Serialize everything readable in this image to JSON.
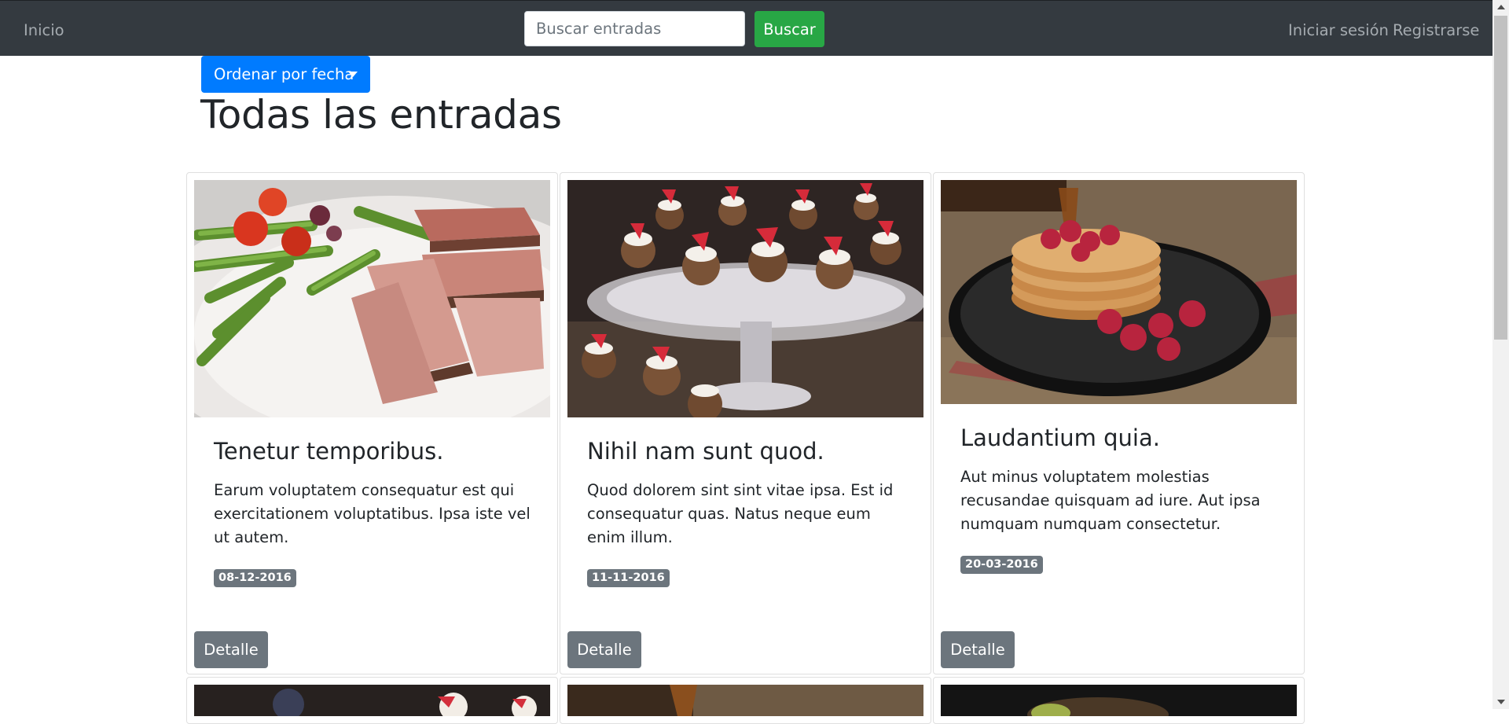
{
  "nav": {
    "home": "Inicio",
    "search_placeholder": "Buscar entradas",
    "search_button": "Buscar",
    "login": "Iniciar sesión",
    "register": "Registrarse"
  },
  "sort": {
    "label": "Ordenar por fecha"
  },
  "page": {
    "title": "Todas las entradas"
  },
  "cards": [
    {
      "title": "Tenetur temporibus.",
      "text": "Earum voluptatem consequatur est qui exercitationem voluptatibus. Ipsa iste vel ut autem.",
      "date": "08-12-2016",
      "button": "Detalle"
    },
    {
      "title": "Nihil nam sunt quod.",
      "text": "Quod dolorem sint sint vitae ipsa. Est id consequatur quas. Natus neque eum enim illum.",
      "date": "11-11-2016",
      "button": "Detalle"
    },
    {
      "title": "Laudantium quia.",
      "text": "Aut minus voluptatem molestias recusandae quisquam ad iure. Aut ipsa numquam numquam consectetur.",
      "date": "20-03-2016",
      "button": "Detalle"
    }
  ],
  "colors": {
    "navbar": "#343a40",
    "success": "#28a745",
    "primary": "#007bff",
    "secondary": "#6c757d"
  }
}
